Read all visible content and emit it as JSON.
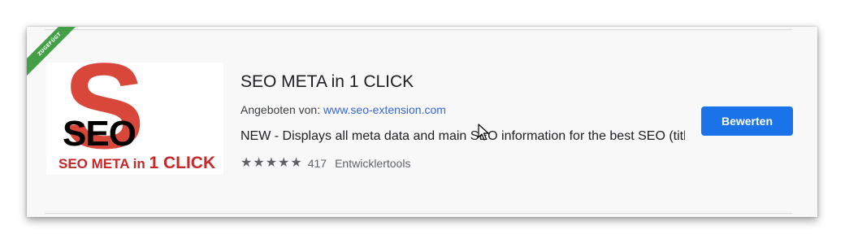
{
  "extension": {
    "badge": "ZUGEFÜGT",
    "thumbnail": {
      "big_letter": "S",
      "word": "SEO",
      "tagline_prefix": "SEO META in ",
      "tagline_suffix": "1 CLICK"
    },
    "title": "SEO META in 1 CLICK",
    "offered_by_label": "Angeboten von:",
    "offered_by_link": "www.seo-extension.com",
    "description": "NEW - Displays all meta data and main SEO information for the best SEO (title, description, keywords...)",
    "rating_stars": 5,
    "rating_count": "417",
    "category": "Entwicklertools",
    "action_button": "Bewerten"
  },
  "colors": {
    "badge_green": "#43a047",
    "button_blue": "#1a73e8",
    "link_blue": "#3367d6",
    "logo_red": "#d9473b"
  }
}
